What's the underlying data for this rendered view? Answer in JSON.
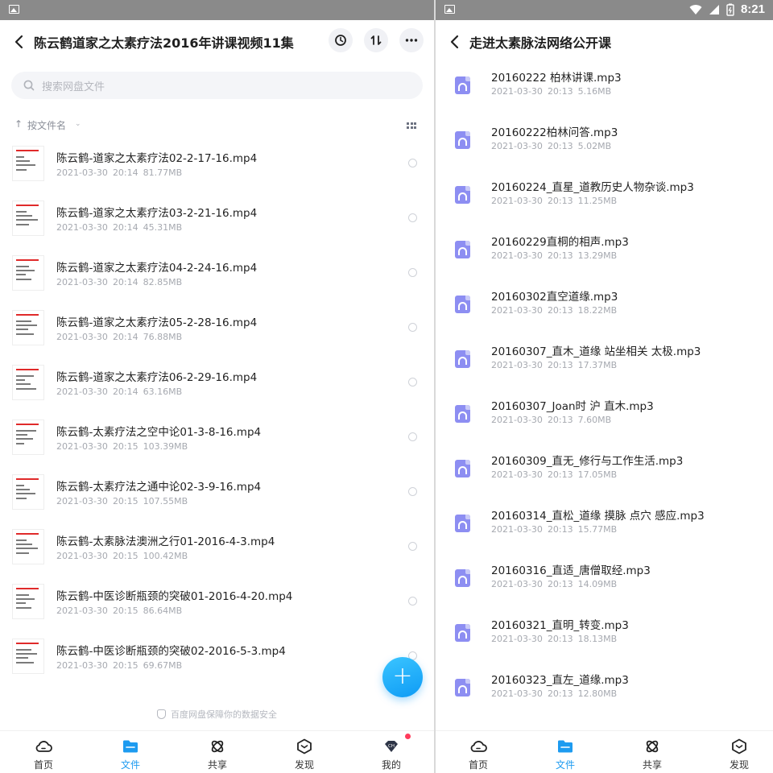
{
  "status_bar": {
    "time": "8:21"
  },
  "left": {
    "title": "陈云鹤道家之太素疗法2016年讲课视频11集",
    "search_placeholder": "搜索网盘文件",
    "sort_label": "按文件名",
    "files": [
      {
        "name": "陈云鹤-道家之太素疗法02-2-17-16.mp4",
        "date": "2021-03-30",
        "time": "20:14",
        "size": "81.77MB"
      },
      {
        "name": "陈云鹤-道家之太素疗法03-2-21-16.mp4",
        "date": "2021-03-30",
        "time": "20:14",
        "size": "45.31MB"
      },
      {
        "name": "陈云鹤-道家之太素疗法04-2-24-16.mp4",
        "date": "2021-03-30",
        "time": "20:14",
        "size": "82.85MB"
      },
      {
        "name": "陈云鹤-道家之太素疗法05-2-28-16.mp4",
        "date": "2021-03-30",
        "time": "20:14",
        "size": "76.88MB"
      },
      {
        "name": "陈云鹤-道家之太素疗法06-2-29-16.mp4",
        "date": "2021-03-30",
        "time": "20:14",
        "size": "63.16MB"
      },
      {
        "name": "陈云鹤-太素疗法之空中论01-3-8-16.mp4",
        "date": "2021-03-30",
        "time": "20:15",
        "size": "103.39MB"
      },
      {
        "name": "陈云鹤-太素疗法之通中论02-3-9-16.mp4",
        "date": "2021-03-30",
        "time": "20:15",
        "size": "107.55MB"
      },
      {
        "name": "陈云鹤-太素脉法澳洲之行01-2016-4-3.mp4",
        "date": "2021-03-30",
        "time": "20:15",
        "size": "100.42MB"
      },
      {
        "name": "陈云鹤-中医诊断瓶颈的突破01-2016-4-20.mp4",
        "date": "2021-03-30",
        "time": "20:15",
        "size": "86.64MB"
      },
      {
        "name": "陈云鹤-中医诊断瓶颈的突破02-2016-5-3.mp4",
        "date": "2021-03-30",
        "time": "20:15",
        "size": "69.67MB"
      }
    ],
    "footer_note": "百度网盘保障你的数据安全",
    "tabs": [
      {
        "label": "首页",
        "icon": "cloud-icon"
      },
      {
        "label": "文件",
        "icon": "folder-icon"
      },
      {
        "label": "共享",
        "icon": "share-icon"
      },
      {
        "label": "发现",
        "icon": "discover-icon"
      },
      {
        "label": "我的",
        "icon": "profile-icon"
      }
    ]
  },
  "right": {
    "title": "走进太素脉法网络公开课",
    "files": [
      {
        "name": "20160222 柏林讲课.mp3",
        "date": "2021-03-30",
        "time": "20:13",
        "size": "5.16MB"
      },
      {
        "name": "20160222柏林问答.mp3",
        "date": "2021-03-30",
        "time": "20:13",
        "size": "5.02MB"
      },
      {
        "name": "20160224_直星_道教历史人物杂谈.mp3",
        "date": "2021-03-30",
        "time": "20:13",
        "size": "11.25MB"
      },
      {
        "name": "20160229直桐的相声.mp3",
        "date": "2021-03-30",
        "time": "20:13",
        "size": "13.29MB"
      },
      {
        "name": "20160302直空道缘.mp3",
        "date": "2021-03-30",
        "time": "20:13",
        "size": "18.22MB"
      },
      {
        "name": "20160307_直木_道缘 站坐相关 太极.mp3",
        "date": "2021-03-30",
        "time": "20:13",
        "size": "17.37MB"
      },
      {
        "name": "20160307_Joan时 沪 直木.mp3",
        "date": "2021-03-30",
        "time": "20:13",
        "size": "7.60MB"
      },
      {
        "name": "20160309_直无_修行与工作生活.mp3",
        "date": "2021-03-30",
        "time": "20:13",
        "size": "17.05MB"
      },
      {
        "name": "20160314_直松_道缘 摸脉 点穴 感应.mp3",
        "date": "2021-03-30",
        "time": "20:13",
        "size": "15.77MB"
      },
      {
        "name": "20160316_直适_唐僧取经.mp3",
        "date": "2021-03-30",
        "time": "20:13",
        "size": "14.09MB"
      },
      {
        "name": "20160321_直明_转变.mp3",
        "date": "2021-03-30",
        "time": "20:13",
        "size": "18.13MB"
      },
      {
        "name": "20160323_直左_道缘.mp3",
        "date": "2021-03-30",
        "time": "20:13",
        "size": "12.80MB"
      }
    ],
    "tabs": [
      {
        "label": "首页",
        "icon": "cloud-icon"
      },
      {
        "label": "文件",
        "icon": "folder-icon"
      },
      {
        "label": "共享",
        "icon": "share-icon"
      },
      {
        "label": "发现",
        "icon": "discover-icon"
      }
    ]
  },
  "colors": {
    "accent": "#1d9bf0",
    "audio_icon": "#8d8ef2",
    "badge": "#ff3b5c"
  }
}
